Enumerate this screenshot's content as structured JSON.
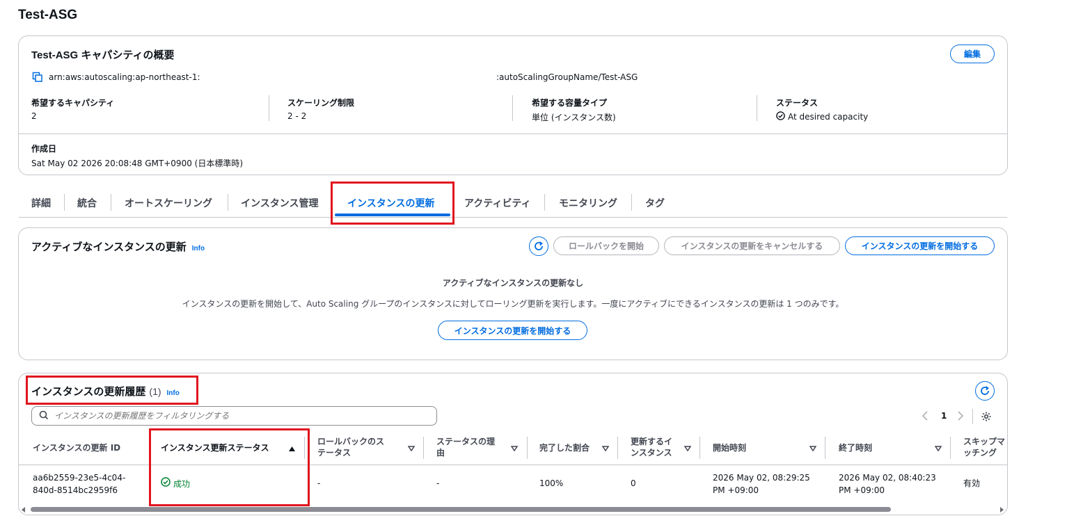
{
  "page": {
    "title": "Test-ASG"
  },
  "capacity": {
    "title": "Test-ASG キャパシティの概要",
    "edit_label": "編集",
    "arn_prefix": "arn:aws:autoscaling:ap-northeast-1:",
    "arn_suffix": ":autoScalingGroupName/Test-ASG",
    "fields": [
      {
        "label": "希望するキャパシティ",
        "value": "2"
      },
      {
        "label": "スケーリング制限",
        "value": "2 - 2"
      },
      {
        "label": "希望する容量タイプ",
        "value": "単位 (インスタンス数)"
      },
      {
        "label": "ステータス",
        "value": "At desired capacity"
      }
    ],
    "created_label": "作成日",
    "created_value": "Sat May 02 2026 20:08:48 GMT+0900 (日本標準時)"
  },
  "tabs": [
    "詳細",
    "統合",
    "オートスケーリング",
    "インスタンス管理",
    "インスタンスの更新",
    "アクティビティ",
    "モニタリング",
    "タグ"
  ],
  "active_refresh": {
    "title": "アクティブなインスタンスの更新",
    "info": "Info",
    "rollback_label": "ロールバックを開始",
    "cancel_label": "インスタンスの更新をキャンセルする",
    "start_label": "インスタンスの更新を開始する",
    "empty_title": "アクティブなインスタンスの更新なし",
    "empty_desc": "インスタンスの更新を開始して、Auto Scaling グループのインスタンスに対してローリング更新を実行します。一度にアクティブにできるインスタンスの更新は 1 つのみです。",
    "empty_button": "インスタンスの更新を開始する"
  },
  "history": {
    "title": "インスタンスの更新履歴",
    "count": "(1)",
    "info": "Info",
    "filter_placeholder": "インスタンスの更新履歴をフィルタリングする",
    "page_number": "1",
    "columns": [
      [
        "インスタンスの更新 ID"
      ],
      [
        "インスタンス更新ステータス"
      ],
      [
        "ロールバックのス",
        "テータス"
      ],
      [
        "ステータスの理",
        "由"
      ],
      [
        "完了した割合"
      ],
      [
        "更新するイ",
        "ンスタンス"
      ],
      [
        "開始時刻"
      ],
      [
        "終了時刻"
      ],
      [
        "スキップマ",
        "ッチング"
      ]
    ],
    "row": {
      "id": [
        "aa6b2559-23e5-4c04-",
        "840d-8514bc2959f6"
      ],
      "status": "成功",
      "rollback": "-",
      "reason": "-",
      "percent": "100%",
      "instances": "0",
      "start": [
        "2026 May 02, 08:29:25",
        "PM +09:00"
      ],
      "end": [
        "2026 May 02, 08:40:23",
        "PM +09:00"
      ],
      "skip": "有効"
    }
  },
  "colors": {
    "accent": "#006ce0",
    "success": "#00802f",
    "highlight": "#e0141e"
  }
}
